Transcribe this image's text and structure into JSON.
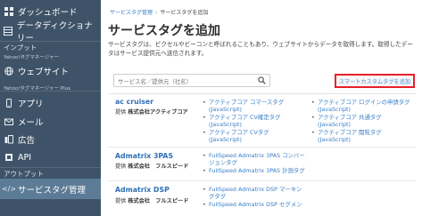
{
  "sidebar": {
    "items": [
      {
        "label": "ダッシュボード",
        "icon": "dashboard-icon"
      },
      {
        "label": "データディクショナリー",
        "icon": "table-icon"
      },
      {
        "label": "ウェブサイト",
        "icon": "globe-icon"
      },
      {
        "label": "アプリ",
        "icon": "mobile-icon"
      },
      {
        "label": "メール",
        "icon": "mail-icon"
      },
      {
        "label": "広告",
        "icon": "ad-icon"
      },
      {
        "label": "API",
        "icon": "api-icon"
      },
      {
        "label": "サービスタグ管理",
        "icon": "code-icon"
      }
    ],
    "sections": {
      "input": "インプット",
      "input_sub": "Yahoo!タグマネージャー",
      "input_sub2": "Yahoo!タグマネージャー Plus",
      "output": "アウトプット"
    }
  },
  "breadcrumb": {
    "parent": "サービスタグ管理",
    "current": "サービスタグを追加"
  },
  "page": {
    "title": "サービスタグを追加",
    "description": "サービスタグは、ピクセルやビーコンと呼ばれることもあり、ウェブサイトからデータを取得します。取得したデータはサービス提供元へ送信されます。"
  },
  "search": {
    "placeholder": "サービス名／提供元（社名）"
  },
  "add_button": {
    "label": "スマートカスタムタグを追加"
  },
  "providers": [
    {
      "name": "ac cruiser",
      "by_label": "提供",
      "company": "株式会社アクティブコア",
      "col1": [
        "アクティブコア コマースタグ",
        "(JavaScript)",
        "アクティブコア CV確定タグ",
        "(JavaScript)",
        "アクティブコア CVタグ",
        "(JavaScript)"
      ],
      "col2": [
        "アクティブコア ログインの申請タグ",
        "(JavaScript)",
        "アクティブコア 共通タグ",
        "(JavaScript)",
        "アクティブコア 閲覧タグ",
        "(JavaScript)"
      ]
    },
    {
      "name": "Admatrix 3PAS",
      "by_label": "提供",
      "company": "株式会社　フルスピード",
      "col1": [
        "FullSpeed Admatrix 3PAS コンバー",
        "ジョンタグ",
        "FullSpeed Admatrix 3PAS 計測タグ"
      ],
      "col2": []
    },
    {
      "name": "Admatrix DSP",
      "by_label": "提供",
      "company": "株式会社　フルスピード",
      "col1": [
        "FullSpeed Admatrix DSP マーキン",
        "グタグ",
        "FullSpeed Admatrix DSP セグメン"
      ],
      "col2": []
    }
  ],
  "colors": {
    "sidebar_bg": "#3f5368",
    "active_bg": "#5b7b96",
    "link": "#3a7fc8",
    "highlight_border": "#e8202a"
  }
}
